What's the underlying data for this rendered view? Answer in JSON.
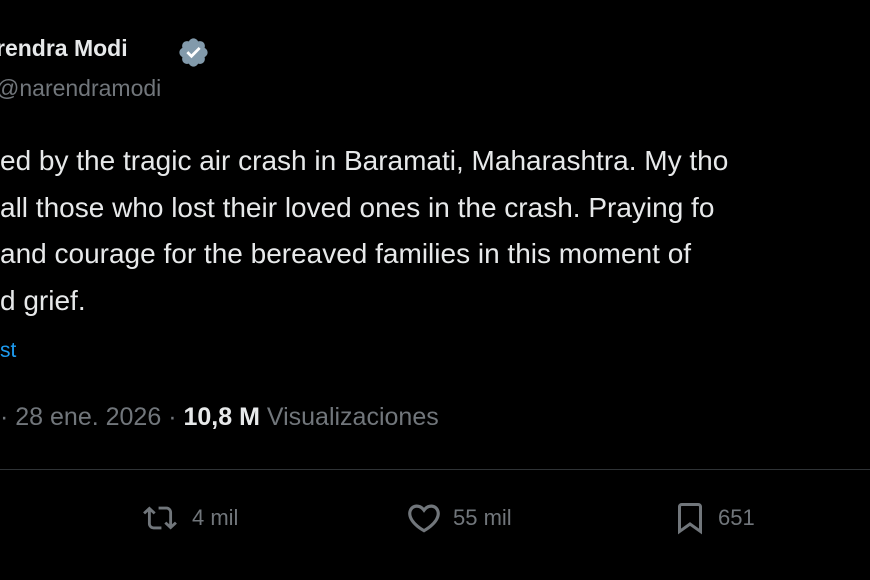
{
  "author": {
    "name": "rendra Modi",
    "handle": "narendramodi",
    "verified": true
  },
  "tweet": {
    "lines": [
      "ed by the tragic air crash in Baramati, Maharashtra. My tho",
      "all those who lost their loved ones in the crash. Praying fo",
      "and courage for the bereaved families in this moment of",
      "d grief."
    ],
    "translate_label": "st"
  },
  "meta": {
    "date": "· 28 ene. 2026 ·",
    "views_count": "10,8 M",
    "views_label": "Visualizaciones"
  },
  "actions": {
    "retweets": "4 mil",
    "likes": "55 mil",
    "bookmarks": "651"
  },
  "icons": {
    "verified": "verified-badge-icon",
    "retweet": "retweet-icon",
    "like": "heart-icon",
    "bookmark": "bookmark-icon"
  },
  "colors": {
    "background": "#000000",
    "text": "#e7e9ea",
    "muted": "#71767b",
    "link": "#1d9bf0",
    "divider": "#2f3336"
  }
}
